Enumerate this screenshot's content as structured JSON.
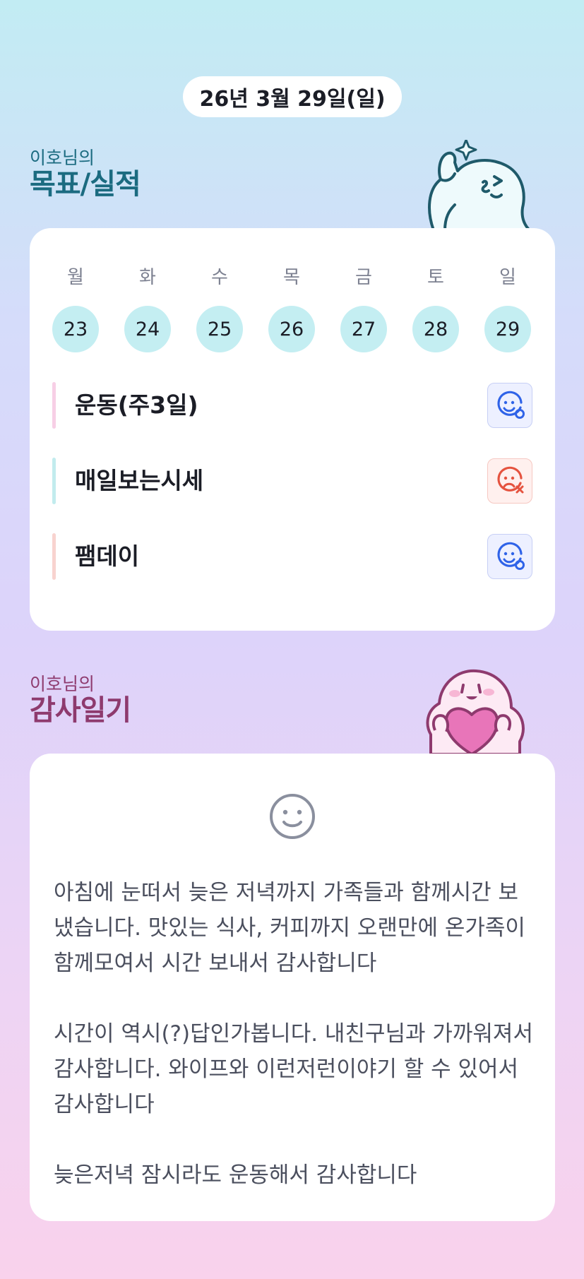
{
  "date_label": "26년 3월 29일(일)",
  "goals_section": {
    "subtitle": "이호님의",
    "title": "목표/실적"
  },
  "week": [
    {
      "name": "월",
      "date": "23"
    },
    {
      "name": "화",
      "date": "24"
    },
    {
      "name": "수",
      "date": "25"
    },
    {
      "name": "목",
      "date": "26"
    },
    {
      "name": "금",
      "date": "27"
    },
    {
      "name": "토",
      "date": "28"
    },
    {
      "name": "일",
      "date": "29"
    }
  ],
  "goals": [
    {
      "label": "운동(주3일)",
      "status": "achieved",
      "bar_color": "#f7cfe6",
      "icon": "smile-check-icon"
    },
    {
      "label": "매일보는시세",
      "status": "missed",
      "bar_color": "#c2ecee",
      "icon": "frown-x-icon"
    },
    {
      "label": "팸데이",
      "status": "achieved",
      "bar_color": "#f8d3cf",
      "icon": "smile-check-icon"
    }
  ],
  "gratitude_section": {
    "subtitle": "이호님의",
    "title": "감사일기"
  },
  "mood_icon": "smiley-face-icon",
  "diary_paragraphs": [
    "아침에 눈떠서 늦은 저녁까지 가족들과 함께시간 보냈습니다. 맛있는 식사, 커피까지 오랜만에 온가족이 함께모여서 시간 보내서 감사합니다",
    "시간이 역시(?)답인가봅니다. 내친구님과 가까워져서 감사합니다. 와이프와 이런저런이야기 할 수 있어서 감사합니다",
    "늦은저녁 잠시라도 운동해서 감사합니다"
  ],
  "colors": {
    "goals_title": "#1b6b80",
    "gratitude_title": "#8e3a6e",
    "date_circle": "#c4eef2",
    "achieved_icon": "#2f63e8",
    "missed_icon": "#e5533f"
  }
}
